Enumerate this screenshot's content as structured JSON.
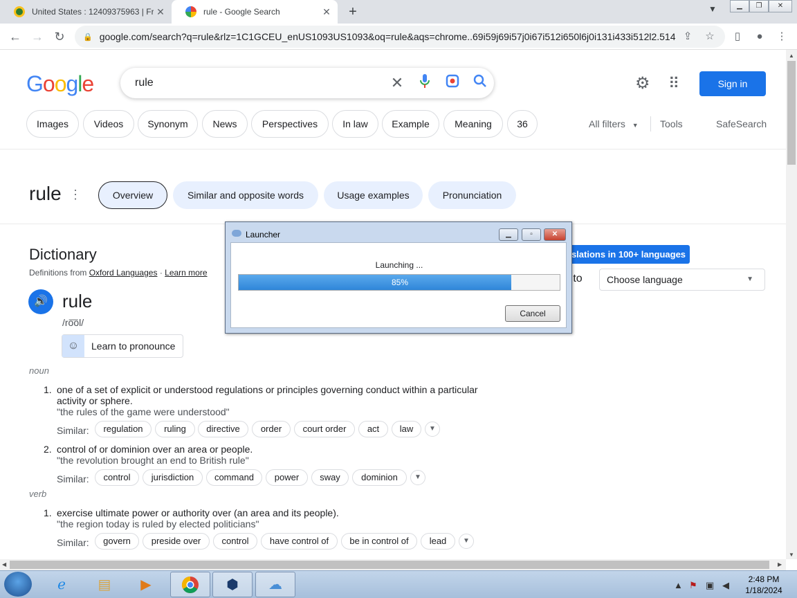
{
  "browser": {
    "tabs": [
      {
        "title": "United States : 12409375963 | Fre",
        "favicon_color": "#2e7d32"
      },
      {
        "title": "rule - Google Search",
        "favicon_color": "#4285f4"
      }
    ],
    "new_tab": "+",
    "url": "google.com/search?q=rule&rlz=1C1GCEU_enUS1093US1093&oq=rule&aqs=chrome..69i59j69i57j0i67i512i650l6j0i131i433i512l2.514..."
  },
  "google": {
    "logo": "Google",
    "query": "rule",
    "sign_in": "Sign in",
    "chips": [
      "Images",
      "Videos",
      "Synonym",
      "News",
      "Perspectives",
      "In law",
      "Example",
      "Meaning",
      "36"
    ],
    "all_filters": "All filters",
    "tools": "Tools",
    "safesearch": "SafeSearch"
  },
  "word_header": {
    "word": "rule",
    "pills": [
      "Overview",
      "Similar and opposite words",
      "Usage examples",
      "Pronunciation"
    ]
  },
  "dictionary": {
    "title": "Dictionary",
    "source_prefix": "Definitions from",
    "source_link": "Oxford Languages",
    "separator": "·",
    "learn_more": "Learn more",
    "headword": "rule",
    "phonetic": "/ro͞ol/",
    "learn_pronounce": "Learn to pronounce",
    "similar_label": "Similar:",
    "noun": "noun",
    "verb": "verb",
    "defs": [
      {
        "num": "1.",
        "text": "one of a set of explicit or understood regulations or principles governing conduct within a particular activity or sphere.",
        "example": "\"the rules of the game were understood\"",
        "similar": [
          "regulation",
          "ruling",
          "directive",
          "order",
          "court order",
          "act",
          "law"
        ]
      },
      {
        "num": "2.",
        "text": "control of or dominion over an area or people.",
        "example": "\"the revolution brought an end to British rule\"",
        "similar": [
          "control",
          "jurisdiction",
          "command",
          "power",
          "sway",
          "dominion"
        ]
      },
      {
        "num": "1.",
        "text": "exercise ultimate power or authority over (an area and its people).",
        "example": "\"the region today is ruled by elected politicians\"",
        "similar": [
          "govern",
          "preside over",
          "control",
          "have control of",
          "be in control of",
          "lead"
        ]
      }
    ]
  },
  "translate": {
    "button": "nslations in 100+ languages",
    "to_label": "e to",
    "choose": "Choose language"
  },
  "launcher": {
    "title": "Launcher",
    "status": "Launching ...",
    "progress": 85,
    "progress_text": "85%",
    "cancel": "Cancel"
  },
  "taskbar": {
    "time": "2:48 PM",
    "date": "1/18/2024"
  },
  "colors": {
    "accent": "#1a73e8",
    "progress": "#2f86d9"
  }
}
